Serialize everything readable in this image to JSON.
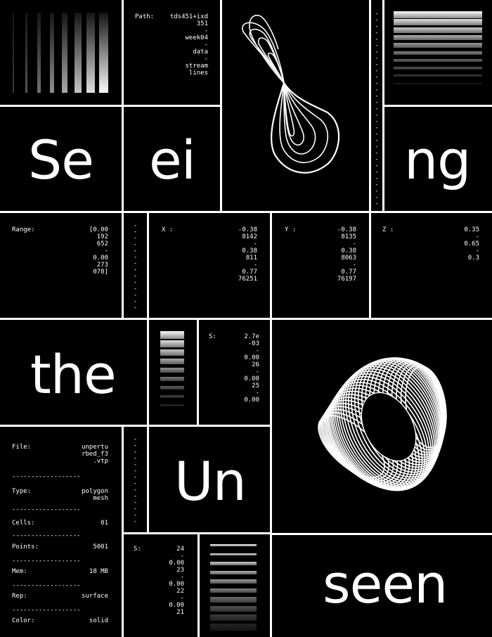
{
  "words": {
    "se": "Se",
    "ei": "ei",
    "ng": "ng",
    "the": "the",
    "un": "Un",
    "seen": "seen"
  },
  "path": {
    "label": "Path:",
    "value": "tds451+ixd\n351\n-\nweek04\n-\ndata\n-\nstream\nlines"
  },
  "range": {
    "label": "Range:",
    "value": "[0.00\n192\n652\n-\n0.00\n273\n078]"
  },
  "x": {
    "label": "X :",
    "value": "-0.38\n8142\n-\n0.38\n811\n-\n0.77\n76251"
  },
  "y": {
    "label": "Y :",
    "value": "-0.38\n8135\n-\n0.38\n8063\n-\n0.77\n76197"
  },
  "z": {
    "label": "Z :",
    "value": "0.35\n-\n0.65\n-\n0.3"
  },
  "s1": {
    "label": "S:",
    "value": "2.7e\n-03\n-\n0.00\n26\n-\n0.00\n25\n-\n0.00"
  },
  "s2": {
    "label": "S:",
    "value": "24\n-\n0.00\n23\n-\n0.00\n22\n-\n0.00\n21"
  },
  "file": {
    "rows": [
      {
        "k": "File:",
        "v": "unpertu\nrbed_f3\n.vtp"
      },
      {
        "k": "Type:",
        "v": "polygon\nmesh"
      },
      {
        "k": "Cells:",
        "v": "01"
      },
      {
        "k": "Points:",
        "v": "5001"
      },
      {
        "k": "Mem:",
        "v": "18 MB"
      },
      {
        "k": "Rep:",
        "v": "surface"
      },
      {
        "k": "Color:",
        "v": "solid"
      }
    ],
    "separator": "------------------"
  },
  "dots_short": "-\n-\n-\n-\n-\n-\n-\n-\n-\n-\n-\n-\n-\n-",
  "dots_long": "-\n-\n-\n-\n-\n-\n-\n-\n-\n-\n-\n-\n-\n-\n-\n-\n-\n-\n-\n-\n-\n-\n-\n-\n-\n-\n-\n-\n-\n-\n-",
  "colors": {
    "background": "#000000",
    "grid_line": "#ffffff",
    "text": "#ffffff"
  }
}
